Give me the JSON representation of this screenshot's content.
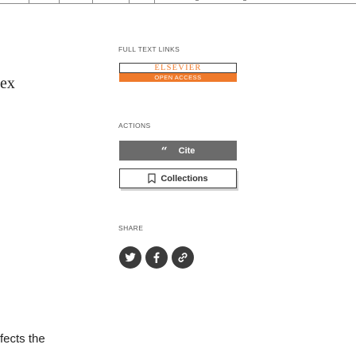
{
  "left_fragment": {
    "word": "ex",
    "line": "fects the"
  },
  "full_text_links": {
    "heading": "FULL TEXT LINKS",
    "publisher_name": "ELSEVIER",
    "access_label": "OPEN ACCESS",
    "colors": {
      "brand_orange": "#ef7a2b"
    }
  },
  "actions": {
    "heading": "ACTIONS",
    "cite_label": "Cite",
    "cite_icon": "quote-icon",
    "collections_label": "Collections",
    "collections_icon": "bookmark-icon",
    "colors": {
      "cite_bg": "#6b6b6b"
    }
  },
  "share": {
    "heading": "SHARE",
    "icons": [
      "twitter-icon",
      "facebook-icon",
      "link-icon"
    ]
  }
}
